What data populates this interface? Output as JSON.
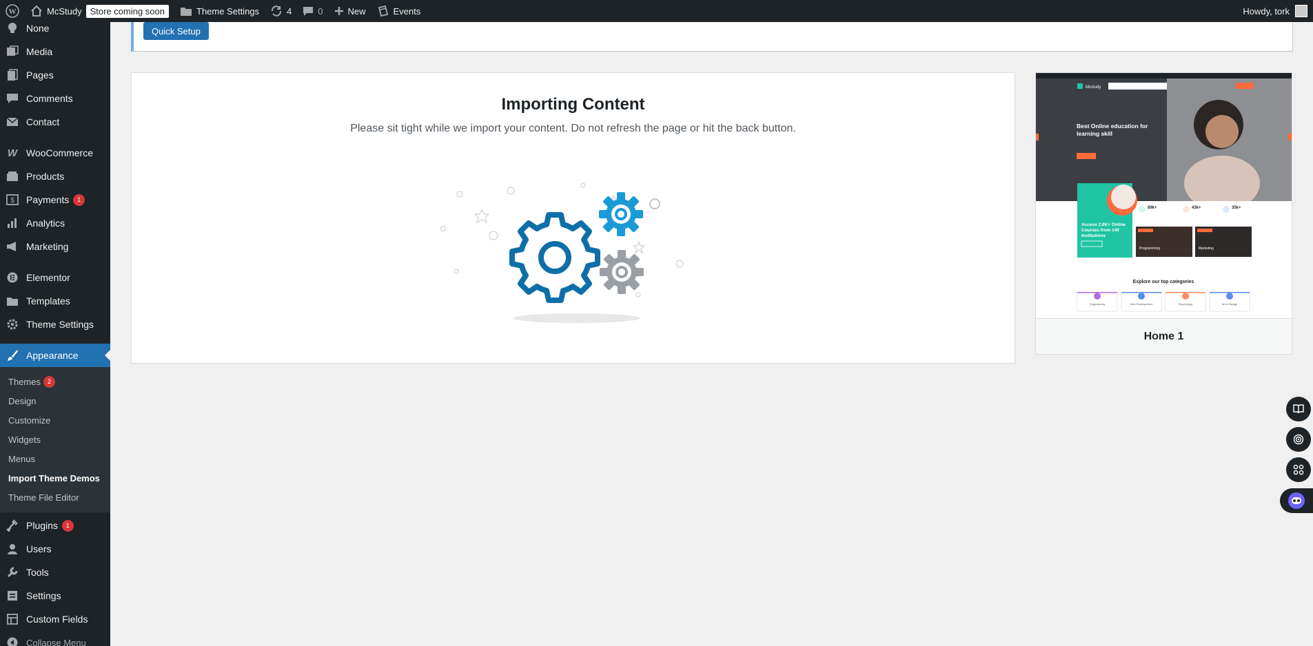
{
  "adminbar": {
    "site_name": "McStudy",
    "store_badge": "Store coming soon",
    "theme_settings": "Theme Settings",
    "updates_count": "4",
    "comments_count": "0",
    "new_label": "New",
    "events_label": "Events",
    "howdy": "Howdy, tork"
  },
  "sidebar": {
    "items_top": [
      {
        "label": "None",
        "icon": "lightbulb-icon"
      },
      {
        "label": "Media",
        "icon": "media-icon"
      },
      {
        "label": "Pages",
        "icon": "pages-icon"
      },
      {
        "label": "Comments",
        "icon": "comments-icon"
      },
      {
        "label": "Contact",
        "icon": "mail-icon"
      }
    ],
    "items_shop": [
      {
        "label": "WooCommerce",
        "icon": "woocommerce-icon"
      },
      {
        "label": "Products",
        "icon": "products-icon"
      },
      {
        "label": "Payments",
        "icon": "payments-icon",
        "badge": "1"
      },
      {
        "label": "Analytics",
        "icon": "analytics-icon"
      },
      {
        "label": "Marketing",
        "icon": "megaphone-icon"
      }
    ],
    "items_design": [
      {
        "label": "Elementor",
        "icon": "elementor-icon"
      },
      {
        "label": "Templates",
        "icon": "folder-icon"
      },
      {
        "label": "Theme Settings",
        "icon": "gear-icon"
      }
    ],
    "appearance": "Appearance",
    "submenu": [
      {
        "label": "Themes",
        "badge": "2"
      },
      {
        "label": "Design"
      },
      {
        "label": "Customize"
      },
      {
        "label": "Widgets"
      },
      {
        "label": "Menus"
      },
      {
        "label": "Import Theme Demos"
      },
      {
        "label": "Theme File Editor"
      }
    ],
    "items_bottom": [
      {
        "label": "Plugins",
        "icon": "plugins-icon",
        "badge": "1"
      },
      {
        "label": "Users",
        "icon": "users-icon"
      },
      {
        "label": "Tools",
        "icon": "wrench-icon"
      },
      {
        "label": "Settings",
        "icon": "settings-icon"
      },
      {
        "label": "Custom Fields",
        "icon": "custom-fields-icon"
      }
    ],
    "collapse": "Collapse Menu"
  },
  "quick_setup": {
    "button": "Quick Setup"
  },
  "import": {
    "title": "Importing Content",
    "subtitle": "Please sit tight while we import your content. Do not refresh the page or hit the back button."
  },
  "preview": {
    "name": "Home 1",
    "hero_title": "Best Online education for learning skill",
    "stat1": "89k+",
    "stat2": "43k+",
    "stat3": "35k+",
    "promo": "Access 2.8K+ Online Courses from 140 Institutions",
    "card1": "Programming",
    "card2": "Marketing",
    "section_title": "Explore our top categories",
    "brand": "Mcstudy",
    "cat1": "Engineering",
    "cat2": "Web Development",
    "cat3": "Psychology",
    "cat4": "Art & Design"
  },
  "colors": {
    "admin_dark": "#1d2327",
    "primary": "#2271b1",
    "badge_red": "#d63638",
    "gear_blue": "#0e6fa8",
    "gear_light_blue": "#1a9bd7",
    "gear_gray": "#9aa0a6"
  }
}
